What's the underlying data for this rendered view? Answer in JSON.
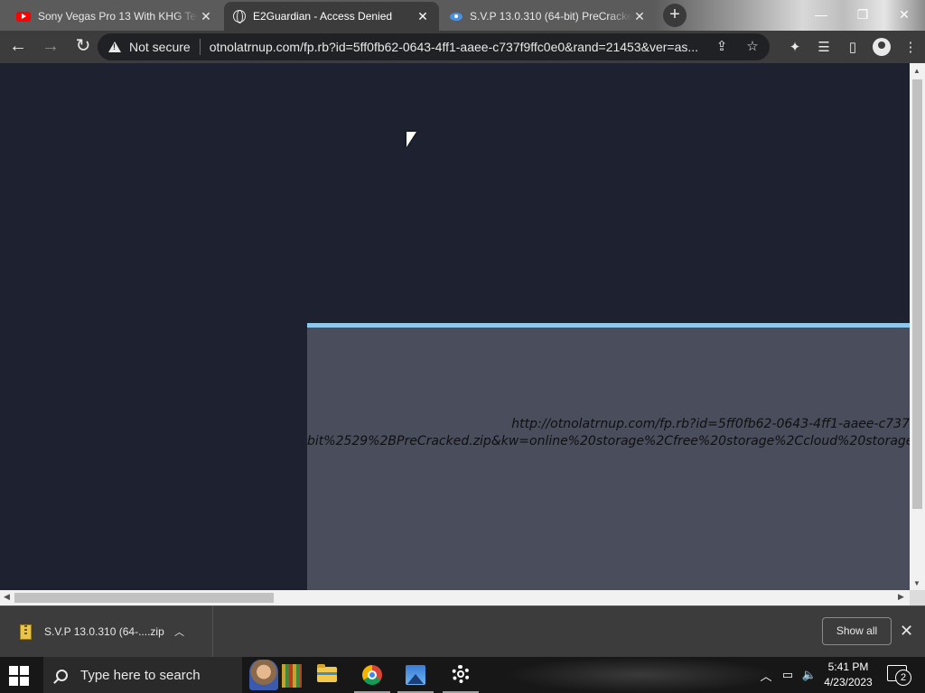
{
  "tabs": [
    {
      "title": "Sony Vegas Pro 13 With KHG Tec",
      "icon": "youtube-icon"
    },
    {
      "title": "E2Guardian - Access Denied",
      "icon": "globe-icon"
    },
    {
      "title": "S.V.P 13.0.310 (64-bit) PreCracke",
      "icon": "eye-icon"
    }
  ],
  "window_controls": {
    "minimize": "—",
    "maximize": "❐",
    "close": "✕"
  },
  "toolbar": {
    "back": "←",
    "forward": "→",
    "reload": "↻",
    "security_label": "Not secure",
    "url": "otnolatrnup.com/fp.rb?id=5ff0fb62-0643-4ff1-aaee-c737f9ffc0e0&rand=21453&ver=as..."
  },
  "page": {
    "url_line1": "http://otnolatrnup.com/fp.rb?id=5ff0fb62-0643-4ff1-aaee-c737",
    "url_line2": "bit%2529%2BPreCracked.zip&kw=online%20storage%2Cfree%20storage%2Ccloud%20storage%2",
    "panel_accent": "#8ec7ee",
    "background": "#1d2130",
    "panel_color": "#494d5c"
  },
  "download_shelf": {
    "item_name": "S.V.P 13.0.310 (64-....zip",
    "show_all": "Show all"
  },
  "taskbar": {
    "search_placeholder": "Type here to search",
    "time": "5:41 PM",
    "date": "4/23/2023",
    "notification_count": "2"
  }
}
